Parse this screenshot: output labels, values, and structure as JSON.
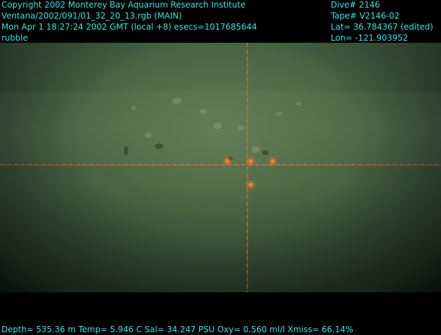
{
  "header": {
    "left": {
      "line1": "Copyright 2002 Monterey Bay Aquarium Research Institute",
      "line2": "Ventana/2002/091/01_32_20_13.rgb (MAIN)",
      "line3": "Mon Apr  1 18:27:24 2002 GMT (local +8)  esecs=1017685644",
      "line4": "rubble"
    },
    "right": {
      "dive": "Dive# 2146",
      "tape": "Tape# V2146-02",
      "lat": "Lat= 36.784367 (edited)",
      "lon": "Lon= -121.903952"
    }
  },
  "footer": {
    "sensors": "Depth= 535.36 m  Temp= 5.946 C  Sal= 34.247 PSU  Oxy= 0.560 ml/l  Xmiss= 66.14%"
  },
  "colors": {
    "overlay_text": "#33e6e6",
    "background": "#000000",
    "laser": "#ff7a30"
  }
}
